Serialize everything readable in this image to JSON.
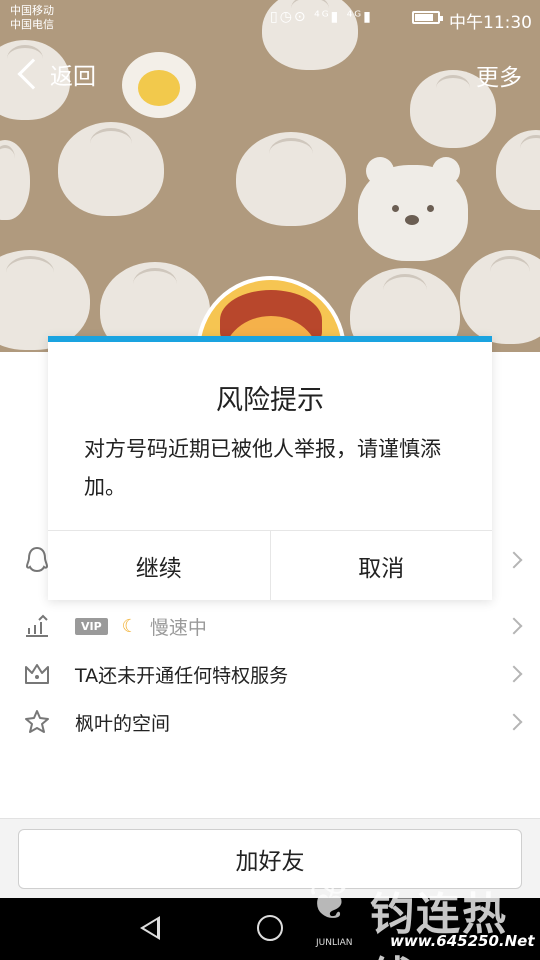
{
  "status_bar": {
    "carrier_1": "中国移动",
    "carrier_2": "中国电信",
    "icons": "▯◷⊙ ⁴ᴳ▮ ⁴ᴳ▮",
    "time": "中午11:30"
  },
  "nav": {
    "back_label": "返回",
    "more_label": "更多"
  },
  "dialog": {
    "title": "风险提示",
    "message": "对方号码近期已被他人举报，请谨慎添加。",
    "continue_label": "继续",
    "cancel_label": "取消",
    "accent_color": "#1aa3e0"
  },
  "list": {
    "rows": [
      {
        "icon": "qq-penguin-icon",
        "text": ""
      },
      {
        "icon": "level-chart-icon",
        "vip_badge": "VIP",
        "moon": "☾",
        "speed_text": "慢速中"
      },
      {
        "icon": "crown-icon",
        "text": "TA还未开通任何特权服务"
      },
      {
        "icon": "star-space-icon",
        "text": "枫叶的空间"
      }
    ]
  },
  "bottom": {
    "add_friend_label": "加好友"
  },
  "watermark": {
    "logo_char": "❦",
    "big_text": "钧连热线",
    "brand": "JUNLIAN",
    "url": "www.645250.Net"
  }
}
